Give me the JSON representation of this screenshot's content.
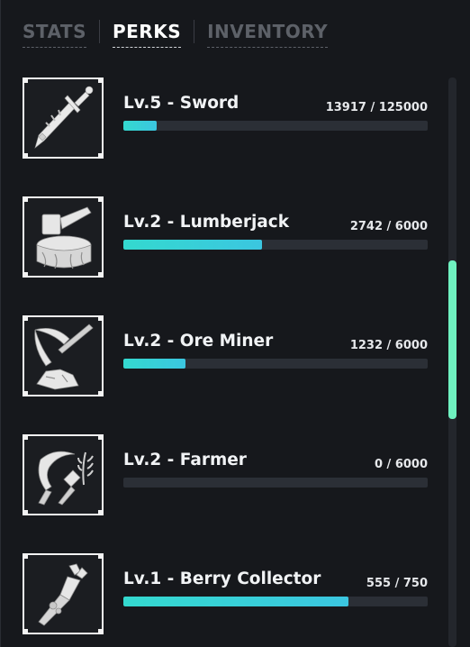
{
  "tabs": [
    {
      "label": "STATS",
      "active": false
    },
    {
      "label": "PERKS",
      "active": true
    },
    {
      "label": "INVENTORY",
      "active": false
    }
  ],
  "perks": [
    {
      "title": "Lv.5 - Sword",
      "xp_text": "13917 / 125000",
      "progress": 0.11,
      "icon": "sword-icon"
    },
    {
      "title": "Lv.2 - Lumberjack",
      "xp_text": "2742 / 6000",
      "progress": 0.457,
      "icon": "axe-stump-icon"
    },
    {
      "title": "Lv.2 - Ore Miner",
      "xp_text": "1232 / 6000",
      "progress": 0.205,
      "icon": "pickaxe-icon"
    },
    {
      "title": "Lv.2 - Farmer",
      "xp_text": "0 / 6000",
      "progress": 0.0,
      "icon": "sickle-hammer-icon"
    },
    {
      "title": "Lv.1 - Berry Collector",
      "xp_text": "555 / 750",
      "progress": 0.74,
      "icon": "berry-claw-icon"
    }
  ],
  "colors": {
    "accent": "#6ff1c0",
    "bar_fill": "#3bd0d8",
    "bar_track": "#2b2f36",
    "background": "#16181c"
  }
}
